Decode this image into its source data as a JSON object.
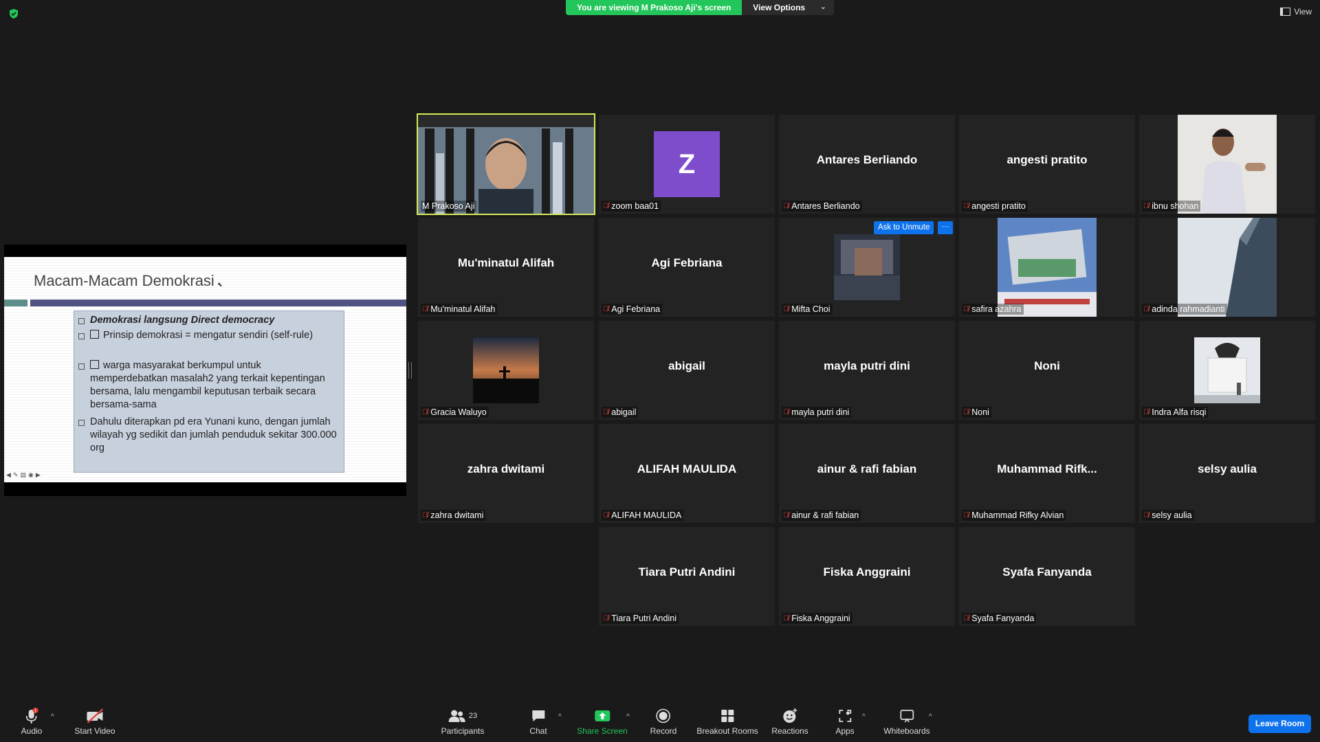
{
  "security_icon": "shield-check-icon",
  "banner": {
    "viewing_text": "You are viewing M Prakoso Aji's screen",
    "options_label": "View Options"
  },
  "view_label": "View",
  "slide": {
    "title": "Macam-Macam Demokrasi",
    "bullets": [
      "Demokrasi langsung Direct democracy",
      "Prinsip demokrasi = mengatur sendiri (self-rule)",
      "warga masyarakat berkumpul untuk memperdebatkan masalah2 yang terkait kepentingan bersama, lalu mengambil keputusan terbaik secara bersama-sama",
      "Dahulu diterapkan pd era Yunani kuno, dengan jumlah wilayah yg sedikit dan jumlah penduduk sekitar 300.000 org"
    ]
  },
  "tiles": [
    {
      "label": "M Prakoso Aji",
      "muted": false
    },
    {
      "label": "zoom baa01",
      "avatar_letter": "Z",
      "muted": true
    },
    {
      "label": "Antares Berliando",
      "display": "Antares Berliando",
      "muted": true
    },
    {
      "label": "angesti pratito",
      "display": "angesti pratito",
      "muted": true
    },
    {
      "label": "ibnu shohan",
      "muted": true
    },
    {
      "label": "Mu'minatul Alifah",
      "display": "Mu'minatul Alifah",
      "muted": true
    },
    {
      "label": "Agi Febriana",
      "display": "Agi Febriana",
      "muted": true
    },
    {
      "label": "Mifta Choi",
      "muted": true
    },
    {
      "label": "safira azahra",
      "muted": true
    },
    {
      "label": "adinda rahmadianti",
      "muted": true
    },
    {
      "label": "Gracia Waluyo",
      "muted": true
    },
    {
      "label": "abigail",
      "display": "abigail",
      "muted": true
    },
    {
      "label": "mayla putri dini",
      "display": "mayla putri dini",
      "muted": true
    },
    {
      "label": "Noni",
      "display": "Noni",
      "muted": true
    },
    {
      "label": "Indra Alfa risqi",
      "muted": true
    },
    {
      "label": "zahra dwitami",
      "display": "zahra dwitami",
      "muted": true
    },
    {
      "label": "ALIFAH MAULIDA",
      "display": "ALIFAH MAULIDA",
      "muted": true
    },
    {
      "label": "ainur & rafi fabian",
      "display": "ainur & rafi fabian",
      "muted": true
    },
    {
      "label": "Muhammad Rifky Alvian",
      "display": "Muhammad  Rifk...",
      "muted": true
    },
    {
      "label": "selsy aulia",
      "display": "selsy aulia",
      "muted": true
    },
    {
      "label": "Tiara Putri Andini",
      "display": "Tiara Putri Andini",
      "muted": true
    },
    {
      "label": "Fiska Anggraini",
      "display": "Fiska Anggraini",
      "muted": true
    },
    {
      "label": "Syafa Fanyanda",
      "display": "Syafa Fanyanda",
      "muted": true
    }
  ],
  "tile_actions": {
    "ask_unmute": "Ask to Unmute",
    "more": "···"
  },
  "toolbar": {
    "audio": "Audio",
    "start_video": "Start Video",
    "participants": "Participants",
    "participants_count": "23",
    "chat": "Chat",
    "share_screen": "Share Screen",
    "record": "Record",
    "breakout_rooms": "Breakout Rooms",
    "reactions": "Reactions",
    "apps": "Apps",
    "whiteboards": "Whiteboards",
    "leave": "Leave Room",
    "audio_badge": "!"
  },
  "colors": {
    "accent_blue": "#0e72ed",
    "share_green": "#23c65a",
    "active_speaker": "#d8eb5a",
    "muted_red": "#e5423a"
  }
}
